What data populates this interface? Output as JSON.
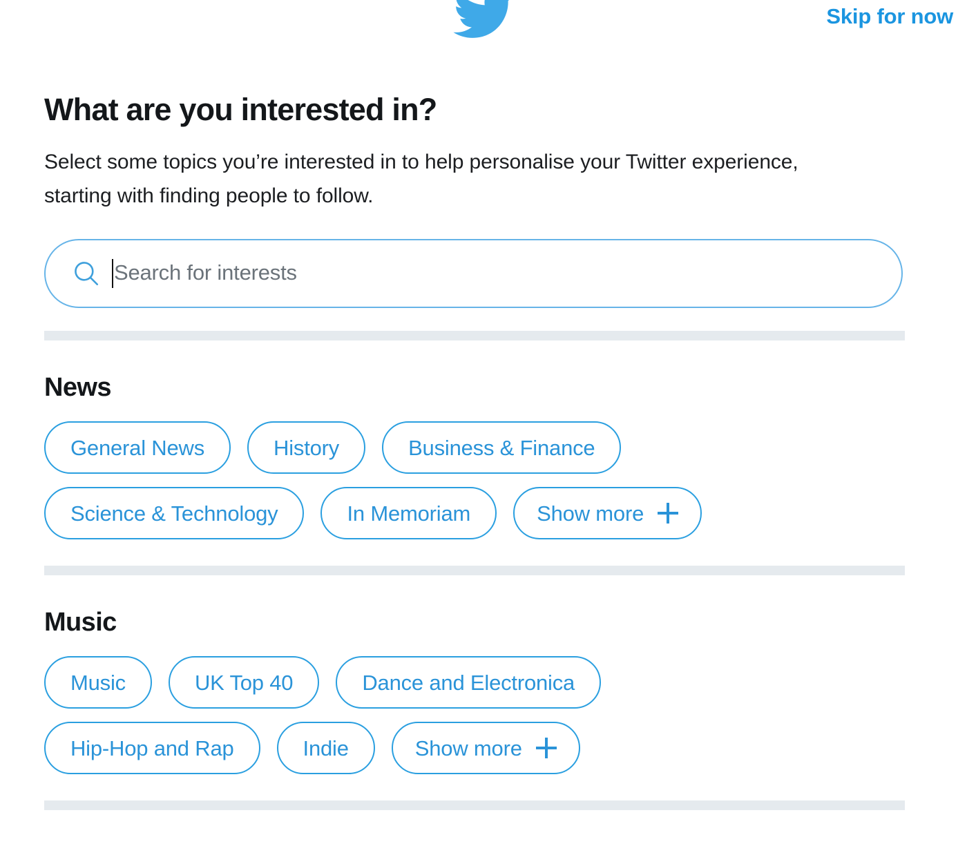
{
  "header": {
    "logo_icon": "twitter-bird-icon",
    "skip_label": "Skip for now"
  },
  "main": {
    "title": "What are you interested in?",
    "subtitle": "Select some topics you’re interested in to help personalise your Twitter experience, starting with finding people to follow."
  },
  "search": {
    "icon": "search-icon",
    "placeholder": "Search for interests",
    "value": ""
  },
  "sections": [
    {
      "title": "News",
      "rows": [
        [
          {
            "label": "General News",
            "type": "topic"
          },
          {
            "label": "History",
            "type": "topic"
          },
          {
            "label": "Business & Finance",
            "type": "topic"
          }
        ],
        [
          {
            "label": "Science & Technology",
            "type": "topic"
          },
          {
            "label": "In Memoriam",
            "type": "topic"
          },
          {
            "label": "Show more",
            "type": "show-more",
            "icon": "plus-icon"
          }
        ]
      ]
    },
    {
      "title": "Music",
      "rows": [
        [
          {
            "label": "Music",
            "type": "topic"
          },
          {
            "label": "UK Top 40",
            "type": "topic"
          },
          {
            "label": "Dance and Electronica",
            "type": "topic"
          }
        ],
        [
          {
            "label": "Hip-Hop and Rap",
            "type": "topic"
          },
          {
            "label": "Indie",
            "type": "topic"
          },
          {
            "label": "Show more",
            "type": "show-more",
            "icon": "plus-icon"
          }
        ]
      ]
    }
  ],
  "colors": {
    "accent": "#1b95e0",
    "chip_border": "#2a9fe0",
    "chip_text": "#2a93d8",
    "separator": "#e5eaee",
    "placeholder": "#6b737a",
    "heading": "#14171a"
  }
}
